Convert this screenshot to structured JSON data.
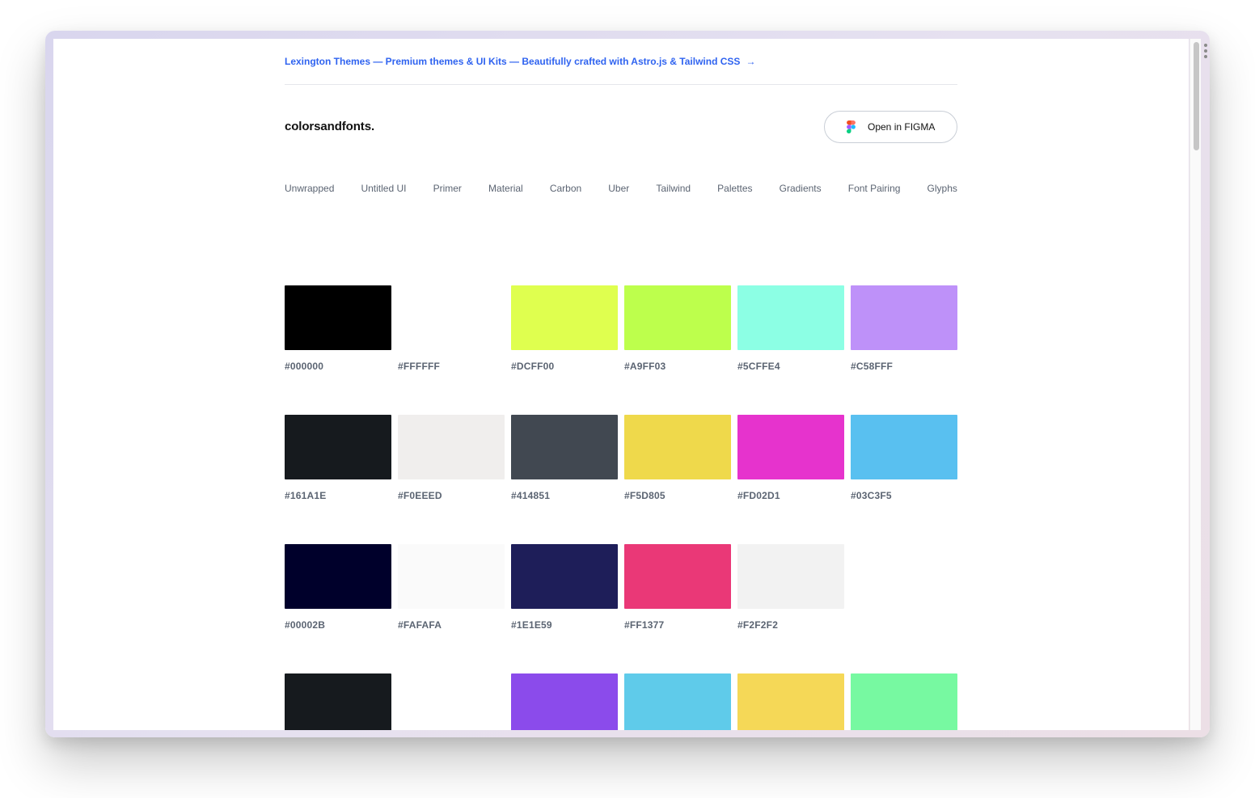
{
  "banner": {
    "text": "Lexington Themes — Premium themes & UI Kits — Beautifully crafted with Astro.js & Tailwind CSS",
    "arrow": "→"
  },
  "header": {
    "logo": "colorsandfonts.",
    "figma_button": "Open in FIGMA"
  },
  "nav": {
    "items": [
      "Unwrapped",
      "Untitled UI",
      "Primer",
      "Material",
      "Carbon",
      "Uber",
      "Tailwind",
      "Palettes",
      "Gradients",
      "Font Pairing",
      "Glyphs"
    ]
  },
  "palette": {
    "rows": [
      [
        {
          "hex": "#000000",
          "color": "#000000"
        },
        {
          "hex": "#FFFFFF",
          "color": "#FFFFFF"
        },
        {
          "hex": "#DCFF00",
          "color": "#DFFF4F"
        },
        {
          "hex": "#A9FF03",
          "color": "#BDFF4C"
        },
        {
          "hex": "#5CFFE4",
          "color": "#8CFFE4"
        },
        {
          "hex": "#C58FFF",
          "color": "#BE91F9"
        }
      ],
      [
        {
          "hex": "#161A1E",
          "color": "#161A1E"
        },
        {
          "hex": "#F0EEED",
          "color": "#F0EEED"
        },
        {
          "hex": "#414851",
          "color": "#414851"
        },
        {
          "hex": "#F5D805",
          "color": "#EFD94B"
        },
        {
          "hex": "#FD02D1",
          "color": "#E633CD"
        },
        {
          "hex": "#03C3F5",
          "color": "#59C0F0"
        }
      ],
      [
        {
          "hex": "#00002B",
          "color": "#00002B"
        },
        {
          "hex": "#FAFAFA",
          "color": "#FAFAFA"
        },
        {
          "hex": "#1E1E59",
          "color": "#1E1E59"
        },
        {
          "hex": "#FF1377",
          "color": "#EA3877"
        },
        {
          "hex": "#F2F2F2",
          "color": "#F2F2F2"
        }
      ],
      [
        {
          "hex": "",
          "color": "#161A1E"
        },
        {
          "hex": "",
          "color": "#FFFFFF"
        },
        {
          "hex": "",
          "color": "#8B4BEB"
        },
        {
          "hex": "",
          "color": "#5FCBEA"
        },
        {
          "hex": "",
          "color": "#F5D857"
        },
        {
          "hex": "",
          "color": "#77F9A1"
        }
      ]
    ]
  },
  "colors": {
    "link": "#2F63F0",
    "muted_text": "#5B6472",
    "window_gradient": "#DCD8EE"
  }
}
